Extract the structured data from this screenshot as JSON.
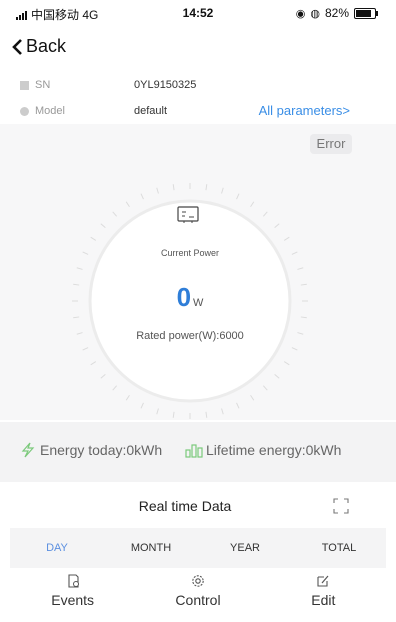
{
  "status_bar": {
    "carrier": "中国移动 4G",
    "time": "14:52",
    "battery": "82%",
    "battery_level": 0.82
  },
  "nav": {
    "back_label": "Back"
  },
  "device": {
    "sn_label": "SN",
    "sn_value": "0YL9150325",
    "model_label": "Model",
    "model_value": "default",
    "all_params_link": "All parameters>"
  },
  "status_badge": "Error",
  "power": {
    "label": "Current Power",
    "value": "0",
    "unit": "W",
    "rated": "Rated power(W):6000"
  },
  "energy": {
    "today": "Energy today:0kWh",
    "lifetime": "Lifetime energy:0kWh"
  },
  "realtime": {
    "title": "Real time Data",
    "tabs": [
      "DAY",
      "MONTH",
      "YEAR",
      "TOTAL"
    ],
    "active_tab": "DAY"
  },
  "bottom_nav": [
    {
      "label": "Events",
      "icon": "events-icon"
    },
    {
      "label": "Control",
      "icon": "gear-icon"
    },
    {
      "label": "Edit",
      "icon": "edit-icon"
    }
  ],
  "colors": {
    "accent": "#3a8ee6",
    "power_value": "#2f7ed8",
    "energy_icon": "#7bc97b"
  }
}
